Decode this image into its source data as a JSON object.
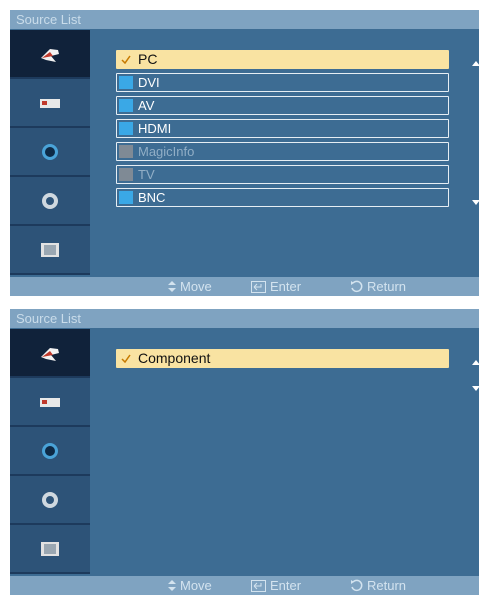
{
  "menus": [
    {
      "title": "Source List",
      "sidebar": [
        {
          "icon": "input-icon",
          "active": true
        },
        {
          "icon": "picture-icon",
          "active": false
        },
        {
          "icon": "sound-icon",
          "active": false
        },
        {
          "icon": "setup-icon",
          "active": false
        },
        {
          "icon": "multi-control-icon",
          "active": false
        }
      ],
      "items": [
        {
          "label": "PC",
          "state": "selected"
        },
        {
          "label": "DVI",
          "state": "normal"
        },
        {
          "label": "AV",
          "state": "normal"
        },
        {
          "label": "HDMI",
          "state": "normal"
        },
        {
          "label": "MagicInfo",
          "state": "disabled"
        },
        {
          "label": "TV",
          "state": "disabled"
        },
        {
          "label": "BNC",
          "state": "normal"
        }
      ],
      "scroll_up": true,
      "scroll_down": true,
      "footer": {
        "move": "Move",
        "enter": "Enter",
        "return": "Return"
      }
    },
    {
      "title": "Source List",
      "sidebar": [
        {
          "icon": "input-icon",
          "active": true
        },
        {
          "icon": "picture-icon",
          "active": false
        },
        {
          "icon": "sound-icon",
          "active": false
        },
        {
          "icon": "setup-icon",
          "active": false
        },
        {
          "icon": "multi-control-icon",
          "active": false
        }
      ],
      "items": [
        {
          "label": "Component",
          "state": "selected"
        }
      ],
      "scroll_up": true,
      "scroll_down": true,
      "footer": {
        "move": "Move",
        "enter": "Enter",
        "return": "Return"
      }
    }
  ],
  "colors": {
    "panel": "#3d6c93",
    "title_bar": "#7fa3c1",
    "sidebar": "#2d5378",
    "sidebar_active": "#10223a",
    "selected_item": "#f9e3a2",
    "source_bar": "#3aa8e6",
    "disabled_bar": "#7f8a95"
  }
}
